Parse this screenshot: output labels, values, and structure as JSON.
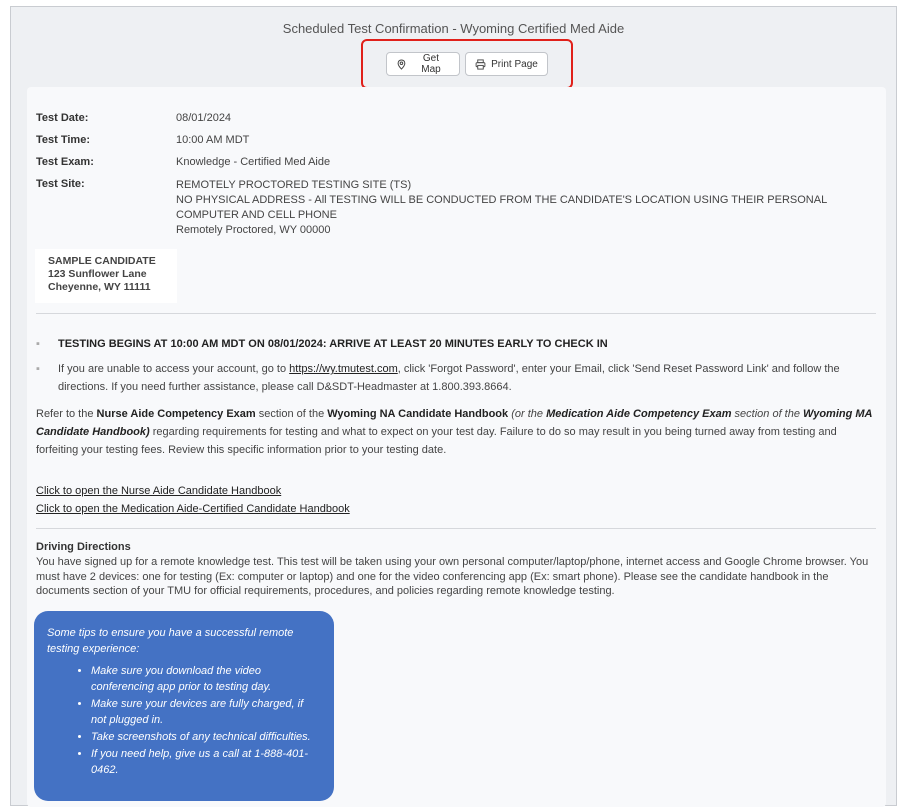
{
  "header": {
    "title": "Scheduled Test Confirmation - Wyoming Certified Med Aide",
    "get_map_label": "Get Map",
    "print_page_label": "Print Page"
  },
  "details": {
    "test_date_label": "Test Date:",
    "test_date": "08/01/2024",
    "test_time_label": "Test Time:",
    "test_time": "10:00 AM MDT",
    "test_exam_label": "Test Exam:",
    "test_exam": "Knowledge - Certified Med Aide",
    "test_site_label": "Test Site:",
    "site_name": "REMOTELY PROCTORED TESTING SITE (TS)",
    "site_address": "NO PHYSICAL ADDRESS - All TESTING WILL BE CONDUCTED FROM THE CANDIDATE'S LOCATION USING THEIR PERSONAL COMPUTER AND CELL PHONE",
    "site_city": "Remotely Proctored, WY 00000"
  },
  "candidate": {
    "name": "SAMPLE CANDIDATE",
    "street": "123 Sunflower Lane",
    "city": "Cheyenne, WY 11111"
  },
  "notices": {
    "bullet1": "TESTING BEGINS AT 10:00 AM MDT ON 08/01/2024:  ARRIVE AT LEAST 20 MINUTES EARLY TO CHECK IN",
    "bullet2_pre": "If you are unable to access your account, go to ",
    "bullet2_link": "https://wy.tmutest.com",
    "bullet2_post": ", click 'Forgot Password', enter your Email, click 'Send Reset Password Link' and follow the directions.  If you need further assistance, please call D&SDT-Headmaster at 1.800.393.8664."
  },
  "handbook_para": {
    "p1": "Refer to the ",
    "b1": "Nurse Aide Competency Exam",
    "p2": " section of the ",
    "b2": "Wyoming NA Candidate Handbook",
    "i1": " (or the ",
    "bi1": "Medication Aide Competency Exam",
    "i2": " section of the ",
    "bi2": "Wyoming MA Candidate Handbook)",
    "p3": " regarding requirements for testing and what to expect on your test day.  Failure to do so may result in you being turned away from testing and forfeiting your testing fees.  Review this specific information prior to your testing date."
  },
  "links": {
    "nurse_aide": "Click to open the Nurse Aide Candidate Handbook",
    "med_aide": "Click to open the Medication Aide-Certified Candidate Handbook"
  },
  "driving": {
    "title": "Driving Directions",
    "text": "You have signed up for a remote knowledge test. This test will be taken using your own personal computer/laptop/phone, internet access and Google Chrome browser. You must have 2 devices: one for testing (Ex: computer or laptop) and one for the video conferencing app (Ex: smart phone). Please see the candidate handbook in the documents section of your TMU for official requirements, procedures, and policies regarding remote knowledge testing."
  },
  "tips": {
    "title": "Some tips to ensure you have a successful remote testing experience:",
    "items": [
      "Make sure you download the video conferencing app prior to testing day.",
      "Make sure your devices are fully charged, if not plugged in.",
      "Take screenshots of any technical difficulties.",
      "If you need help, give us a call at 1-888-401-0462."
    ]
  },
  "colors": {
    "highlight": "#e0201a",
    "tips_bg": "#4472c4"
  }
}
